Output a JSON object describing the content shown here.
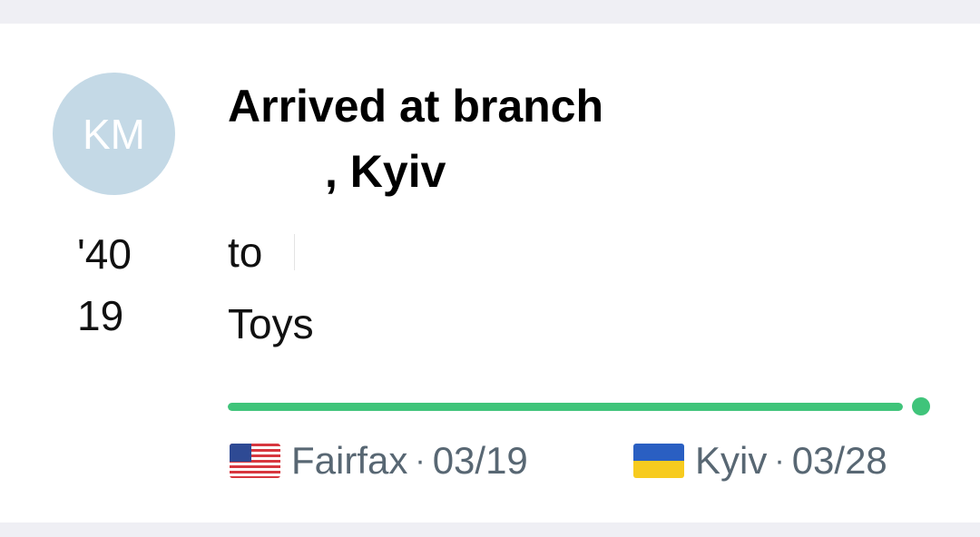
{
  "card": {
    "avatar_initials": "KM",
    "year_line_1": "'40",
    "year_line_2": "19",
    "title_line_1": "Arrived at branch",
    "title_line_2": ", Kyiv",
    "to_label": "to",
    "item_label": "Toys",
    "progress": 1.0,
    "route": {
      "from_city": "Fairfax",
      "from_date": "03/19",
      "to_city": "Kyiv",
      "to_date": "03/28",
      "separator": "·"
    }
  },
  "colors": {
    "avatar_bg": "#c4d9e6",
    "progress_green": "#3fc47a",
    "route_text": "#586773"
  },
  "icons": {
    "from_flag": "us-flag-icon",
    "to_flag": "ukraine-flag-icon"
  }
}
